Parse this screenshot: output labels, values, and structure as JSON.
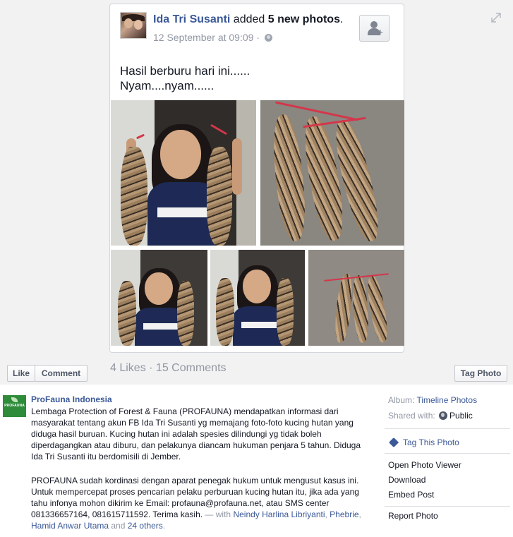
{
  "post": {
    "author": "Ida Tri Susanti",
    "action_prefix": " added ",
    "photo_count": "5 new photos",
    "action_suffix": ".",
    "timestamp": "12 September at 09:09",
    "separator": " · ",
    "caption": "Hasil berburu hari ini......\nNyam....nyam......",
    "likes": "4 Likes",
    "dot": " · ",
    "comments": "15 Comments"
  },
  "photo_actions": {
    "like": "Like",
    "comment": "Comment",
    "tag_photo": "Tag Photo"
  },
  "page_post": {
    "author": "ProFauna Indonesia",
    "logo_text": "PROFAUNA",
    "paragraph_1": "Lembaga Protection of Forest & Fauna (PROFAUNA) mendapatkan informasi dari masyarakat tentang akun FB Ida Tri Susanti yg memajang foto-foto kucing hutan yang diduga hasil buruan. Kucing hutan ini adalah spesies dilindungi yg tidak boleh diperdagangkan atau diburu, dan pelakunya diancam hukuman penjara 5 tahun. Diduga Ida Tri Susanti itu berdomisili di Jember.",
    "paragraph_2_text": "PROFAUNA sudah kordinasi dengan aparat penegak hukum untuk mengusut kasus ini. Untuk mempercepat proses pencarian pelaku perburuan kucing hutan itu, jika ada yang tahu infonya mohon dikirim ke Email: profauna@profauna.net, atau SMS center 081336657164, 081615711592. Terima kasih.",
    "with_label": " — with ",
    "tag_1": "Neindy Harlina Libriyanti",
    "comma": ", ",
    "tag_2": "Phebrie",
    "tag_3": "Hamid Anwar Utama",
    "and_label": " and ",
    "tag_others": "24 others",
    "period": "."
  },
  "sidebar": {
    "album_label": "Album: ",
    "album_value": "Timeline Photos",
    "shared_label": "Shared with: ",
    "shared_value": "Public",
    "tag_this_photo": "Tag This Photo",
    "open_photo_viewer": "Open Photo Viewer",
    "download": "Download",
    "embed_post": "Embed Post",
    "report_photo": "Report Photo"
  },
  "icons": {
    "expand": "expand-icon",
    "globe": "globe-icon",
    "add_friend": "add-friend-icon",
    "tag": "tag-icon"
  },
  "colors": {
    "link": "#3b5998",
    "muted": "#9197a3",
    "stage_background": "#f2f2f2",
    "profauna_green": "#2e8b3a"
  }
}
